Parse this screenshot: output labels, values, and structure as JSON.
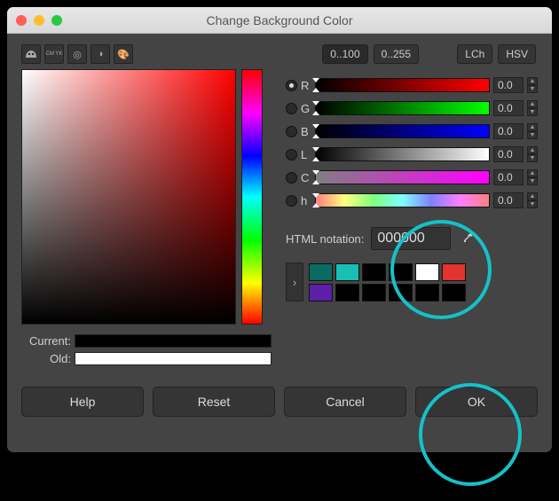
{
  "window": {
    "title": "Change Background Color"
  },
  "toolIcons": {
    "gimp": "G",
    "cmyk": "CM\nYK",
    "watercolor": "◎",
    "wheel": "◑",
    "palette": "🎨"
  },
  "scale": {
    "range100": "0..100",
    "range255": "0..255"
  },
  "model": {
    "lch": "LCh",
    "hsv": "HSV"
  },
  "channels": [
    {
      "key": "R",
      "val": "0.0",
      "sel": true,
      "cls": "sl-r"
    },
    {
      "key": "G",
      "val": "0.0",
      "sel": false,
      "cls": "sl-g"
    },
    {
      "key": "B",
      "val": "0.0",
      "sel": false,
      "cls": "sl-b"
    },
    {
      "key": "L",
      "val": "0.0",
      "sel": false,
      "cls": "sl-l"
    },
    {
      "key": "C",
      "val": "0.0",
      "sel": false,
      "cls": "sl-c"
    },
    {
      "key": "h",
      "val": "0.0",
      "sel": false,
      "cls": "sl-h"
    }
  ],
  "html": {
    "label": "HTML notation:",
    "value": "000000"
  },
  "swatch": {
    "currentLabel": "Current:",
    "oldLabel": "Old:"
  },
  "palette": [
    "#0a6b63",
    "#18c0b4",
    "#000000",
    "#000000",
    "#ffffff",
    "#e3342f",
    "#5b1fa8",
    "#000000",
    "#000000",
    "#000000",
    "#000000",
    "#000000"
  ],
  "buttons": {
    "help": "Help",
    "reset": "Reset",
    "cancel": "Cancel",
    "ok": "OK"
  }
}
